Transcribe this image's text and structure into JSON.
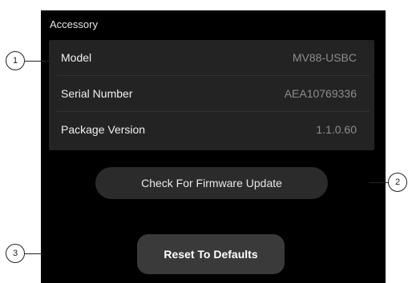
{
  "accessory": {
    "title": "Accessory",
    "rows": [
      {
        "label": "Model",
        "value": "MV88-USBC"
      },
      {
        "label": "Serial Number",
        "value": "AEA10769336"
      },
      {
        "label": "Package Version",
        "value": "1.1.0.60"
      }
    ]
  },
  "actions": {
    "firmware_label": "Check For Firmware Update",
    "reset_label": "Reset To Defaults"
  },
  "callouts": [
    "1",
    "2",
    "3"
  ],
  "colors": {
    "screen_background": "#000000",
    "panel_background": "#232323",
    "firmware_button": "#2b2b2b",
    "reset_button": "#3a3a3a",
    "value_text": "#8c8c8c"
  }
}
